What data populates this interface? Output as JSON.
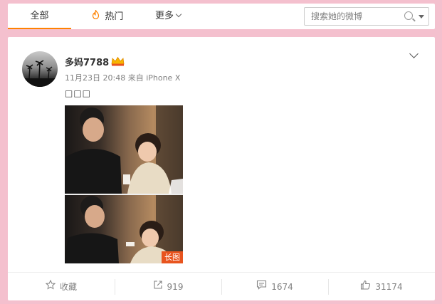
{
  "nav": {
    "tabs": [
      {
        "label": "全部",
        "icon": ""
      },
      {
        "label": "热门",
        "icon": "fire-icon"
      },
      {
        "label": "更多",
        "icon": "chevron-down-icon"
      }
    ],
    "search_placeholder": "搜索她的微博"
  },
  "post": {
    "author": "多妈7788",
    "time": "11月23日 20:48",
    "source": "来自 iPhone X",
    "text": "□□□",
    "image_badge": "长图"
  },
  "actions": {
    "favorite": "收藏",
    "repost": "919",
    "comment": "1674",
    "like": "31174"
  },
  "colors": {
    "background": "#f4c0ce",
    "accent": "#ff8200",
    "badge": "#e8541e"
  }
}
